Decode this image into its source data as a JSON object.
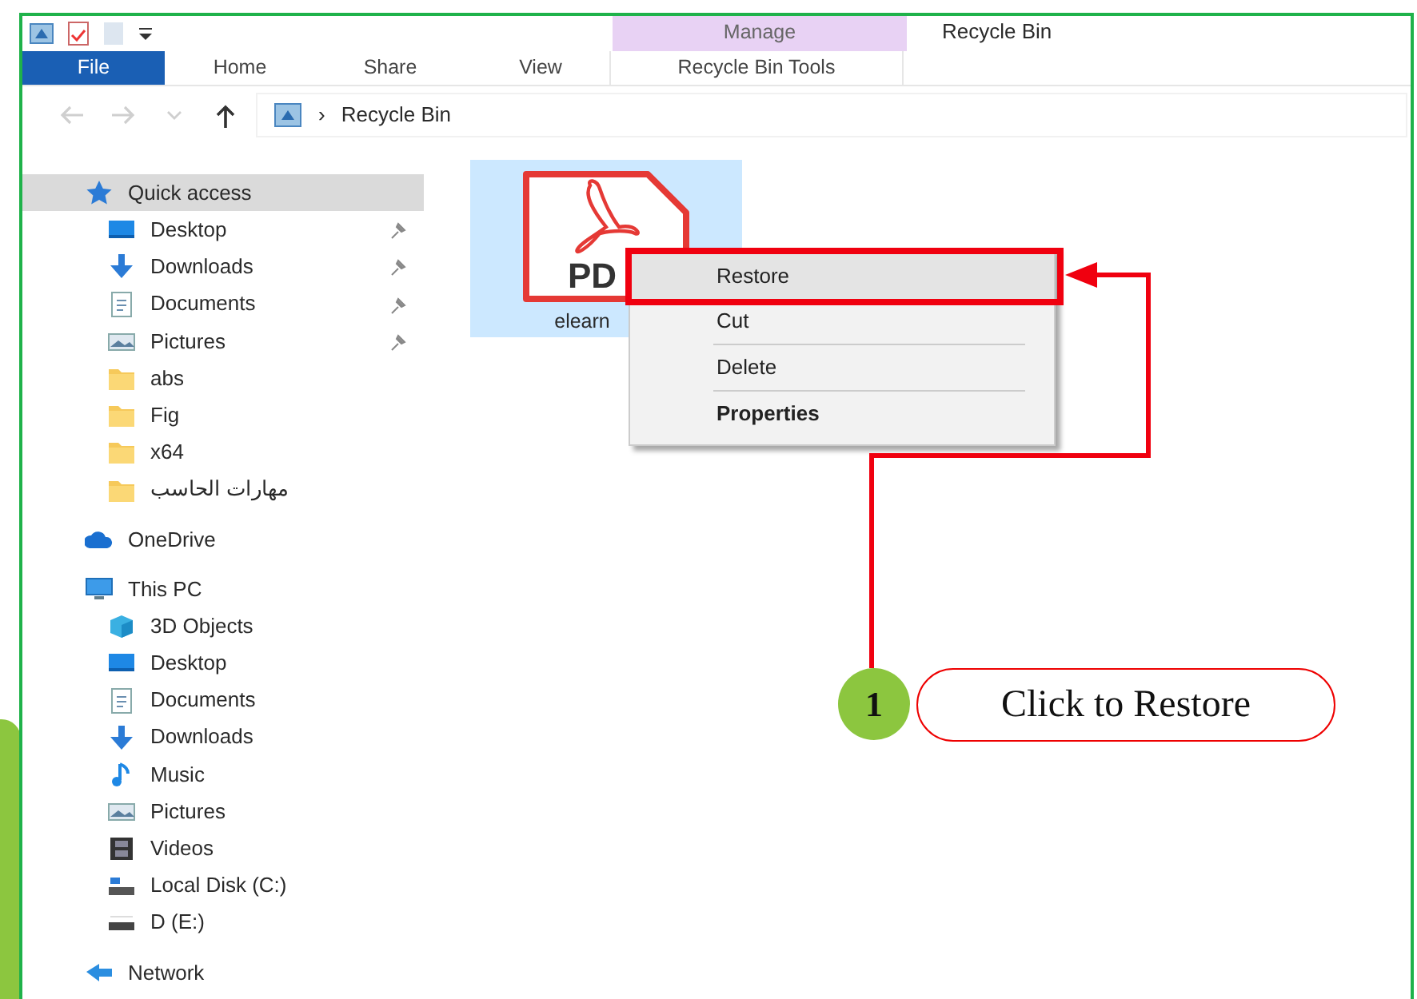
{
  "window": {
    "title": "Recycle Bin",
    "context_header": "Manage"
  },
  "ribbon_tabs": [
    {
      "label": "File",
      "kind": "file"
    },
    {
      "label": "Home",
      "kind": "tab"
    },
    {
      "label": "Share",
      "kind": "tab"
    },
    {
      "label": "View",
      "kind": "tab"
    },
    {
      "label": "Recycle Bin Tools",
      "kind": "contextual"
    }
  ],
  "nav_buttons": [
    {
      "kind": "back",
      "disabled": true
    },
    {
      "kind": "forward",
      "disabled": true
    },
    {
      "kind": "recent",
      "disabled": true
    },
    {
      "kind": "up",
      "disabled": false
    }
  ],
  "address": {
    "separator": "›",
    "path": "Recycle Bin"
  },
  "sidebar": {
    "groups": [
      {
        "label": "Quick access",
        "kind": "star",
        "selected": true,
        "children": [
          {
            "label": "Desktop",
            "kind": "desktop",
            "pinned": true
          },
          {
            "label": "Downloads",
            "kind": "download",
            "pinned": true
          },
          {
            "label": "Documents",
            "kind": "document",
            "pinned": true
          },
          {
            "label": "Pictures",
            "kind": "pictures",
            "pinned": true
          },
          {
            "label": "abs",
            "kind": "folder",
            "pinned": false
          },
          {
            "label": "Fig",
            "kind": "folder",
            "pinned": false
          },
          {
            "label": "x64",
            "kind": "folder",
            "pinned": false
          },
          {
            "label": "مهارات الحاسب",
            "kind": "folder",
            "pinned": false
          }
        ]
      },
      {
        "label": "OneDrive",
        "kind": "cloud",
        "selected": false
      },
      {
        "label": "This PC",
        "kind": "pc",
        "selected": false,
        "children": [
          {
            "label": "3D Objects",
            "kind": "cube",
            "pinned": false
          },
          {
            "label": "Desktop",
            "kind": "desktop",
            "pinned": false
          },
          {
            "label": "Documents",
            "kind": "document",
            "pinned": false
          },
          {
            "label": "Downloads",
            "kind": "download",
            "pinned": false
          },
          {
            "label": "Music",
            "kind": "music",
            "pinned": false
          },
          {
            "label": "Pictures",
            "kind": "pictures",
            "pinned": false
          },
          {
            "label": "Videos",
            "kind": "video",
            "pinned": false
          },
          {
            "label": "Local Disk (C:)",
            "kind": "disk",
            "pinned": false
          },
          {
            "label": "D (E:)",
            "kind": "drive",
            "pinned": false
          }
        ]
      },
      {
        "label": "Network",
        "kind": "network",
        "selected": false
      }
    ]
  },
  "files": [
    {
      "name": "elearn",
      "icon_text": "PD",
      "selected": true
    }
  ],
  "context_menu": {
    "items": [
      {
        "label": "Restore",
        "highlighted": true,
        "bold": false,
        "separator_after": false
      },
      {
        "label": "Cut",
        "highlighted": false,
        "bold": false,
        "separator_after": true
      },
      {
        "label": "Delete",
        "highlighted": false,
        "bold": false,
        "separator_after": true
      },
      {
        "label": "Properties",
        "highlighted": false,
        "bold": true,
        "separator_after": false
      }
    ]
  },
  "callout": {
    "number": "1",
    "text": "Click to Restore"
  }
}
